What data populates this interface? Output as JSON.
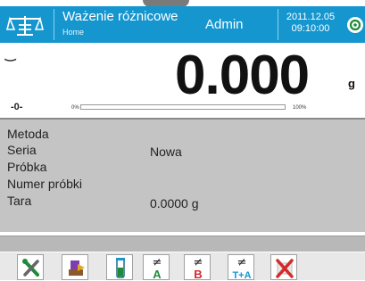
{
  "header": {
    "mode_title": "Ważenie różnicowe",
    "breadcrumb": "Home",
    "user": "Admin",
    "date": "2011.12.05",
    "time": "09:10:00"
  },
  "display": {
    "mass": "0.000",
    "unit": "g",
    "zero_indicator": "-0-",
    "bar_min_label": "0%",
    "bar_max_label": "100%",
    "bar_fill_fraction": 0
  },
  "info": {
    "rows": [
      {
        "label": "Metoda",
        "value": ""
      },
      {
        "label": "Seria",
        "value": "Nowa"
      },
      {
        "label": "Próbka",
        "value": ""
      },
      {
        "label": "Numer próbki",
        "value": ""
      },
      {
        "label": "Tara",
        "value": "0.0000 g"
      }
    ]
  },
  "toolbar": {
    "a_label": "A",
    "b_label": "B",
    "ta_label": "T+A",
    "ne_symbol": "≠"
  },
  "colors": {
    "header_bg": "#1596cf",
    "panel_bg": "#c4c4c4",
    "accent_green": "#1e8a3a",
    "accent_red": "#d42a2a"
  }
}
